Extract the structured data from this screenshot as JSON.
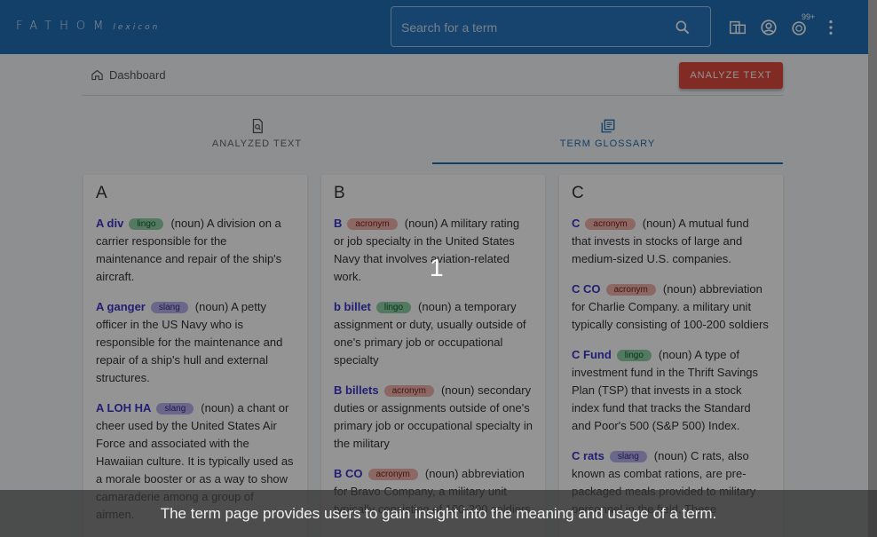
{
  "header": {
    "logo_main": "FATHOM",
    "logo_sub": "lexicon",
    "search_placeholder": "Search for a term",
    "notification_badge": "99+"
  },
  "breadcrumb": {
    "label": "Dashboard"
  },
  "actions": {
    "analyze_label": "ANALYZE TEXT"
  },
  "tabs": [
    {
      "label": "ANALYZED TEXT",
      "icon": "document-search-icon"
    },
    {
      "label": "TERM GLOSSARY",
      "icon": "library-books-icon",
      "active": true
    }
  ],
  "glossary": {
    "columns": [
      {
        "letter": "A",
        "entries": [
          {
            "term": "A div",
            "tag": "lingo",
            "definition": "(noun) A division on a carrier responsible for the maintenance and repair of the ship's aircraft."
          },
          {
            "term": "A ganger",
            "tag": "slang",
            "definition": "(noun) A petty officer in the US Navy who is responsible for the maintenance and repair of a ship's hull and external structures."
          },
          {
            "term": "A LOH HA",
            "tag": "slang",
            "definition": "(noun) a chant or cheer used by the United States Air Force and associated with the Hawaiian culture. It is typically used as a morale booster or as a way to show camaraderie among a group of airmen."
          }
        ]
      },
      {
        "letter": "B",
        "entries": [
          {
            "term": "B",
            "tag": "acronym",
            "definition": "(noun) A military rating or job specialty in the United States Navy that involves aviation-related work."
          },
          {
            "term": "b billet",
            "tag": "lingo",
            "definition": "(noun) a temporary assignment or duty, usually outside of one's primary job or occupational specialty"
          },
          {
            "term": "B billets",
            "tag": "acronym",
            "definition": "(noun) secondary duties or assignments outside of one's primary job or occupational specialty in the military"
          },
          {
            "term": "B CO",
            "tag": "acronym",
            "definition": "(noun) abbreviation for Bravo Company, a military unit typically consisting of 100-200 soldiers"
          }
        ]
      },
      {
        "letter": "C",
        "entries": [
          {
            "term": "C",
            "tag": "acronym",
            "definition": "(noun) A mutual fund that invests in stocks of large and medium-sized U.S. companies."
          },
          {
            "term": "C CO",
            "tag": "acronym",
            "definition": "(noun) abbreviation for Charlie Company. a military unit typically consisting of 100-200 soldiers"
          },
          {
            "term": "C Fund",
            "tag": "lingo",
            "definition": "(noun) A type of investment fund in the Thrift Savings Plan (TSP) that invests in a stock index fund that tracks the Standard and Poor's 500 (S&P 500) Index."
          },
          {
            "term": "C rats",
            "tag": "slang",
            "definition": "(noun) C rats, also known as combat rations, are pre-packaged meals provided to military personnel in the field. These"
          }
        ]
      }
    ]
  },
  "tutorial": {
    "step": "1",
    "caption": "The term page provides users to gain insight into the meaning and usage of a term."
  },
  "colors": {
    "topbar": "#1f6fb5",
    "accent_button": "#e04a3f",
    "term_link": "#3d34c9",
    "acronym": "#f2b4ae",
    "lingo": "#8fd2a6",
    "slang": "#b9b1ee"
  }
}
